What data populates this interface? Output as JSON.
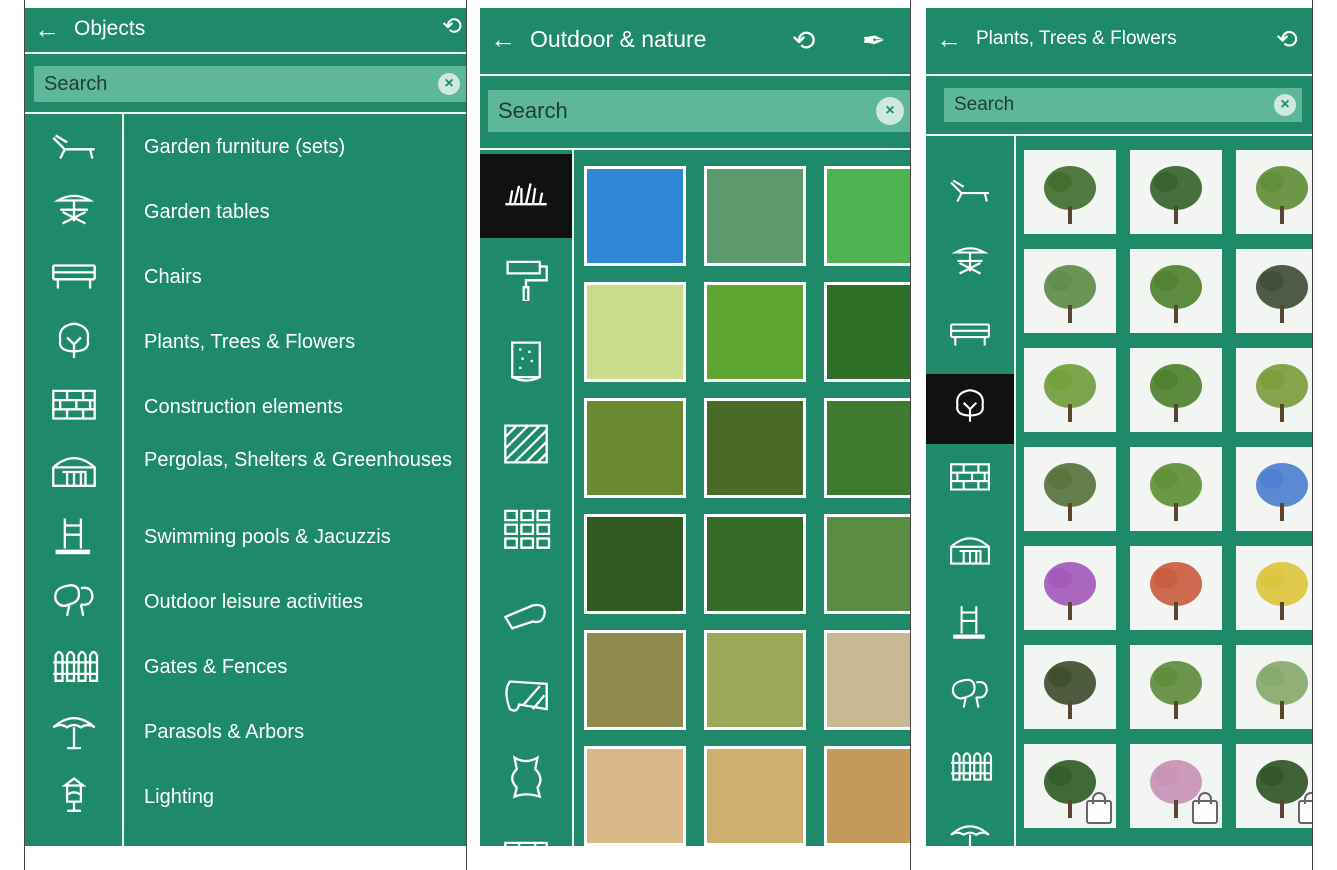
{
  "panel1": {
    "title": "Objects",
    "back": "←",
    "history": "⟲",
    "search_placeholder": "Search",
    "clear": "×",
    "categories": [
      {
        "label": "Garden furniture (sets)",
        "icon": "lounger-icon"
      },
      {
        "label": "Garden tables",
        "icon": "garden-table-icon"
      },
      {
        "label": "Chairs",
        "icon": "bench-icon"
      },
      {
        "label": "Plants, Trees & Flowers",
        "icon": "tree-icon"
      },
      {
        "label": "Construction elements",
        "icon": "bricks-icon"
      },
      {
        "label": "Pergolas, Shelters & Greenhouses",
        "icon": "greenhouse-icon"
      },
      {
        "label": "Swimming pools & Jacuzzis",
        "icon": "pool-ladder-icon"
      },
      {
        "label": "Outdoor leisure activities",
        "icon": "balloons-icon"
      },
      {
        "label": "Gates & Fences",
        "icon": "fence-icon"
      },
      {
        "label": "Parasols & Arbors",
        "icon": "parasol-icon"
      },
      {
        "label": "Lighting",
        "icon": "lantern-icon"
      }
    ]
  },
  "panel2": {
    "title": "Outdoor & nature",
    "back": "←",
    "history": "⟲",
    "eyedropper": "✒",
    "search_placeholder": "Search",
    "clear": "×",
    "side_icons": [
      "grass-icon",
      "paint-roller-icon",
      "wallpaper-roll-icon",
      "hatch-pattern-icon",
      "tiles-icon",
      "carpet-roll-icon",
      "fabric-roll-icon",
      "leather-icon",
      "brick-wall-icon"
    ],
    "textures": [
      "#2f86d4",
      "#5c9a6e",
      "#4fb352",
      "#c9dc8a",
      "#5ea532",
      "#2f6e26",
      "#6a8a30",
      "#4a6a28",
      "#3f7a2e",
      "#2e5a22",
      "#356b28",
      "#5a8c44",
      "#8e8a4e",
      "#9aa858",
      "#c9b894",
      "#dab888",
      "#cdb070",
      "#c49a5a"
    ]
  },
  "panel3": {
    "title": "Plants, Trees & Flowers",
    "back": "←",
    "history": "⟲",
    "search_placeholder": "Search",
    "clear": "×",
    "side_icons": [
      "lounger-icon",
      "garden-table-icon",
      "bench-icon",
      "tree-icon",
      "bricks-icon",
      "greenhouse-icon",
      "pool-ladder-icon",
      "balloons-icon",
      "fence-icon",
      "parasol-icon"
    ],
    "plants": [
      {
        "name": "bush-plant",
        "color": "#3d6b2a",
        "locked": false
      },
      {
        "name": "round-shrub-plant",
        "color": "#33602a",
        "locked": false
      },
      {
        "name": "small-tree-plant",
        "color": "#5f8c35",
        "locked": false
      },
      {
        "name": "palm-plant",
        "color": "#5d8a48",
        "locked": false
      },
      {
        "name": "banana-plant",
        "color": "#4f7f2e",
        "locked": false
      },
      {
        "name": "sparse-shrub-plant",
        "color": "#3e4a34",
        "locked": false
      },
      {
        "name": "oval-topiary-plant",
        "color": "#6f9c38",
        "locked": false
      },
      {
        "name": "columnar-plant",
        "color": "#4b7e2a",
        "locked": false
      },
      {
        "name": "wreath-plant",
        "color": "#7a9b38",
        "locked": false
      },
      {
        "name": "white-flowers-plant",
        "color": "#54703a",
        "locked": false
      },
      {
        "name": "potted-plant",
        "color": "#5c8e34",
        "locked": false
      },
      {
        "name": "blue-flowers-plant",
        "color": "#4a7ecf",
        "locked": false
      },
      {
        "name": "tulips-plant",
        "color": "#a356b8",
        "locked": false
      },
      {
        "name": "mushrooms-plant",
        "color": "#c85a3c",
        "locked": false
      },
      {
        "name": "daffodils-plant",
        "color": "#dcc43a",
        "locked": false
      },
      {
        "name": "hedge-log-plant",
        "color": "#3c4a2a",
        "locked": false
      },
      {
        "name": "potted-bamboo-plant",
        "color": "#5e8a3a",
        "locked": false
      },
      {
        "name": "small-sprout-plant",
        "color": "#86a86a",
        "locked": false
      },
      {
        "name": "cone-topiary-plant",
        "color": "#2d5a24",
        "locked": true
      },
      {
        "name": "pink-blossom-plant",
        "color": "#c890b4",
        "locked": true
      },
      {
        "name": "dark-shrub-plant",
        "color": "#2e5224",
        "locked": true
      }
    ]
  }
}
